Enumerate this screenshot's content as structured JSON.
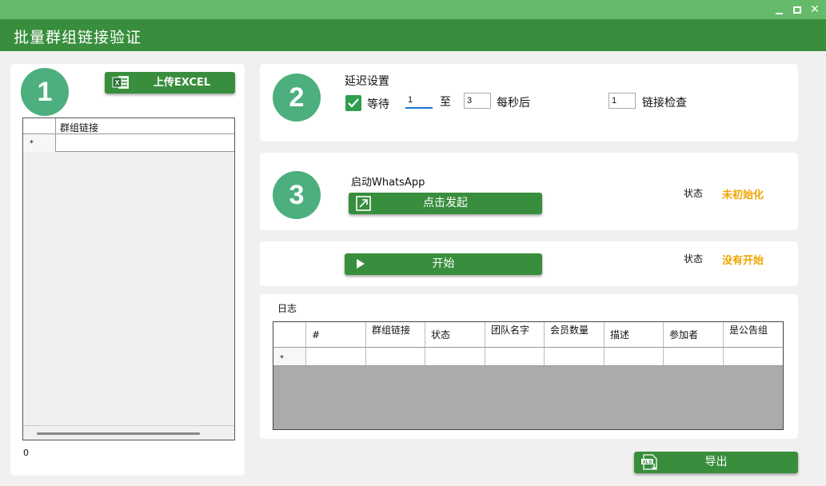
{
  "window": {
    "title": "批量群组链接验证",
    "controls": [
      "minimize-icon",
      "maximize-icon",
      "close-icon"
    ]
  },
  "step1": {
    "number": "1",
    "upload_label": "上传EXCEL",
    "grid_header": "群组链接",
    "new_row_marker": "*",
    "row_count": "0"
  },
  "step2": {
    "number": "2",
    "title": "延迟设置",
    "wait_checked": true,
    "wait_label": "等待",
    "min_value": "1",
    "to_label": "至",
    "max_value": "3",
    "per_second_label": "每秒后",
    "check_value": "1",
    "check_label": "链接检查"
  },
  "step3": {
    "number": "3",
    "title": "启动WhatsApp",
    "launch_label": "点击发起",
    "status_label": "状态",
    "status_value": "未初始化"
  },
  "start": {
    "button_label": "开始",
    "status_label": "状态",
    "status_value": "没有开始"
  },
  "log": {
    "title": "日志",
    "columns": [
      "#",
      "群组链接",
      "状态",
      "团队名字",
      "会员数量",
      "描述",
      "参加者",
      "是公告组"
    ],
    "new_row_marker": "*"
  },
  "export_label": "导出",
  "colors": {
    "titlebar": "#66bb6a",
    "header": "#388e3c",
    "button": "#388e3c",
    "circle": "#4caf7d",
    "status": "#f0a500"
  }
}
